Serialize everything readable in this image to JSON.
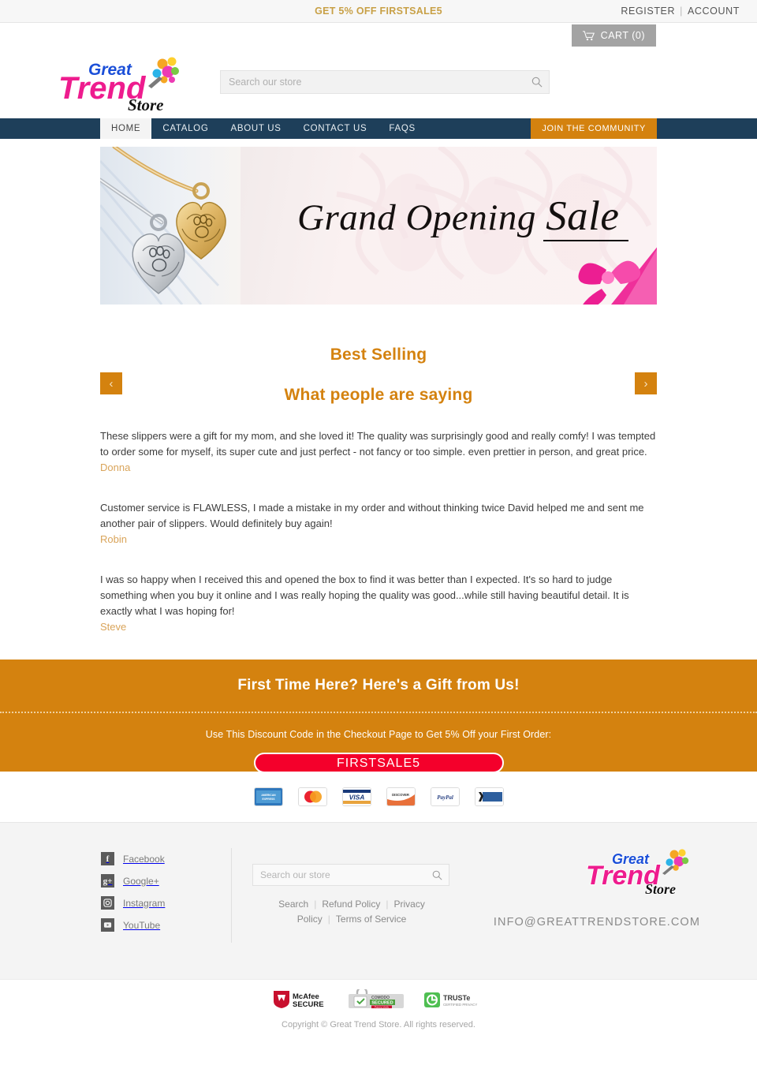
{
  "topbar": {
    "promo": "GET 5% OFF FIRSTSALE5",
    "register": "REGISTER",
    "separator": "|",
    "account": "ACCOUNT"
  },
  "cart": {
    "label": "CART (0)"
  },
  "logo": {
    "word1": "Great",
    "word2": "Trend",
    "word3": "Store",
    "color_word1": "#1b4fd8",
    "color_word2": "#ee1c8e",
    "color_word3": "#111111"
  },
  "search": {
    "placeholder": "Search our store",
    "value": "",
    "icon": "search-icon"
  },
  "nav": {
    "items": [
      {
        "label": "HOME",
        "active": true
      },
      {
        "label": "CATALOG",
        "active": false
      },
      {
        "label": "ABOUT US",
        "active": false
      },
      {
        "label": "CONTACT US",
        "active": false
      },
      {
        "label": "FAQS",
        "active": false
      }
    ],
    "join_label": "JOIN THE COMMUNITY",
    "bar_color": "#1e3f5a",
    "join_color": "#d4820f"
  },
  "banner": {
    "title_main": "Grand Opening ",
    "title_accent": "Sale",
    "alt": "Heart lockets with paw print engraving and pink ribbon"
  },
  "sections": {
    "best_selling": "Best Selling",
    "testimonials_heading": "What people are saying",
    "prev_arrow": "‹",
    "next_arrow": "›",
    "heading_color": "#d4820f"
  },
  "testimonials": [
    {
      "text": "These slippers were a gift for my mom, and she loved it! The quality was surprisingly good and really comfy! I was tempted to order some for myself, its super cute and just perfect - not fancy or too simple. even prettier in person, and great price.",
      "author": "Donna"
    },
    {
      "text": "Customer service is FLAWLESS, I made a mistake in my order and without thinking twice David helped me and sent me another pair of slippers. Would definitely buy again!",
      "author": "Robin"
    },
    {
      "text": "I was so happy when I received this and opened the box to find it was better than I expected. It's so hard to judge something when you buy it online and I was really hoping the quality was good...while still having beautiful detail. It is exactly what I was hoping for!",
      "author": "Steve"
    }
  ],
  "gift": {
    "heading": "First Time Here? Here's a Gift from Us!",
    "subheading": "Use This Discount Code in the Checkout Page to Get 5% Off your First Order:",
    "code": "FIRSTSALE5",
    "band_color": "#d4820f",
    "code_color": "#f4002b"
  },
  "payments": [
    {
      "name": "american-express",
      "label": "AMERICAN EXPRESS"
    },
    {
      "name": "mastercard",
      "label": ""
    },
    {
      "name": "visa",
      "label": "VISA"
    },
    {
      "name": "discover",
      "label": "DISCOVER"
    },
    {
      "name": "paypal",
      "label": "PayPal"
    },
    {
      "name": "amex-check",
      "label": ""
    }
  ],
  "footer": {
    "social": [
      {
        "label": "Facebook",
        "glyph": "f",
        "icon": "facebook-icon"
      },
      {
        "label": "Google+",
        "glyph": "g⁺",
        "icon": "google-plus-icon"
      },
      {
        "label": "Instagram",
        "glyph": "▣",
        "icon": "instagram-icon"
      },
      {
        "label": "YouTube",
        "glyph": "▶",
        "icon": "youtube-icon"
      }
    ],
    "search_placeholder": "Search our store",
    "search_value": "",
    "links": [
      "Search",
      "Refund Policy",
      "Privacy Policy",
      "Terms of Service"
    ],
    "email": "INFO@GREATTRENDSTORE.COM"
  },
  "trust_badges": [
    {
      "name": "mcafee-secure",
      "line1": "McAfee®",
      "line2": "SECURE"
    },
    {
      "name": "comodo-secured",
      "line1": "COMODO",
      "line2": "SECURED",
      "line3": "Point to Verify"
    },
    {
      "name": "truste",
      "line1": "TRUSTe",
      "line2": "CERTIFIED PRIVACY"
    }
  ],
  "copyright": "Copyright © Great Trend Store. All rights reserved."
}
